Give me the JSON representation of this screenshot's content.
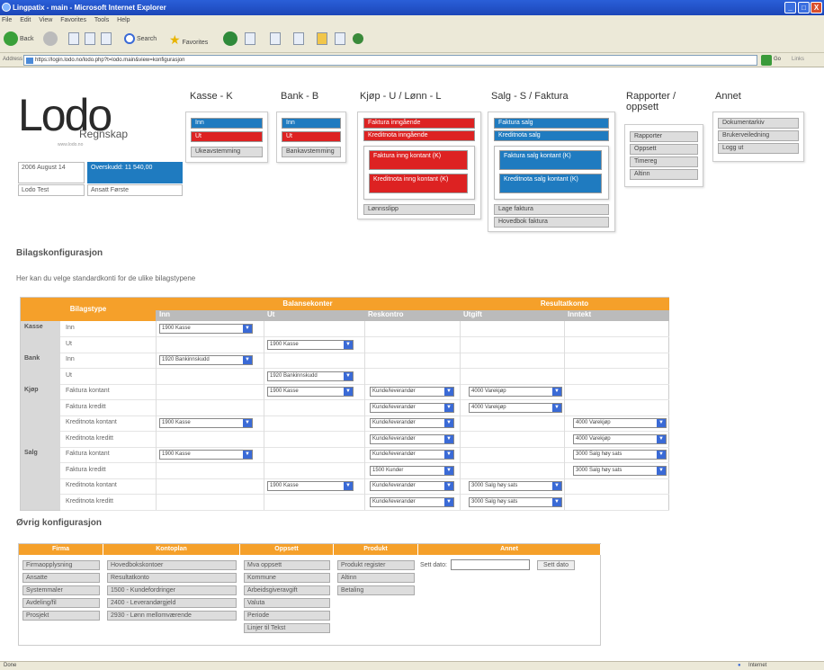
{
  "window": {
    "title": "Lingpatix - main - Microsoft Internet Explorer",
    "controls": [
      "_",
      "□",
      "X"
    ]
  },
  "menubar": [
    "File",
    "Edit",
    "View",
    "Favorites",
    "Tools",
    "Help"
  ],
  "toolbar": {
    "back": "Back",
    "search": "Search",
    "favorites": "Favorites"
  },
  "address": {
    "label": "Address",
    "url": "https://login.lodo.no/lodo.php?t=lodo.main&view=konfigurasjon",
    "go": "Go",
    "links": "Links"
  },
  "logo": {
    "text": "Lodo",
    "sub": "Regnskap",
    "url": "www.lodo.no"
  },
  "info": {
    "date": "2006 August 14",
    "balance": "Overskudd: 11 540,00",
    "company": "Lodo Test",
    "user": "Ansatt Første"
  },
  "menus": {
    "kasse": {
      "title": "Kasse - K",
      "items": [
        "Inn",
        "Ut",
        "Ukeavstemming"
      ]
    },
    "bank": {
      "title": "Bank - B",
      "items": [
        "Inn",
        "Ut",
        "Bankavstemming"
      ]
    },
    "kjop": {
      "title": "Kjøp - U / Lønn - L",
      "items": [
        "Faktura inngående",
        "Kreditnota inngående",
        "Faktura inng kontant (K)",
        "Kreditnota inng kontant (K)",
        "Lønnsslipp"
      ]
    },
    "salg": {
      "title": "Salg - S / Faktura",
      "items": [
        "Faktura salg",
        "Kreditnota salg",
        "Faktura salg kontant (K)",
        "Kreditnota salg kontant (K)",
        "Lage faktura",
        "Hovedbok faktura"
      ]
    },
    "rapporter": {
      "title": "Rapporter / oppsett",
      "items": [
        "Rapporter",
        "Oppsett",
        "Timereg",
        "Altinn"
      ]
    },
    "annet": {
      "title": "Annet",
      "items": [
        "Dokumentarkiv",
        "Brukerveiledning",
        "Logg ut"
      ]
    }
  },
  "bilag": {
    "title": "Bilagskonfigurasjon",
    "desc": "Her kan du velge standardkonti for de ulike bilagstypene",
    "col_bilagstype": "Bilagstype",
    "col_balanse": "Balansekonter",
    "col_resultat": "Resultatkonto",
    "sub": [
      "Inn",
      "Ut",
      "Reskontro",
      "Utgift",
      "Inntekt"
    ],
    "rows": [
      {
        "cat": "Kasse",
        "type": "Inn",
        "inn": "1900 Kasse",
        "ut": "",
        "resk": "",
        "utg": "",
        "innt": ""
      },
      {
        "cat": "",
        "type": "Ut",
        "inn": "",
        "ut": "1900 Kasse",
        "resk": "",
        "utg": "",
        "innt": ""
      },
      {
        "cat": "Bank",
        "type": "Inn",
        "inn": "1920 Bankinnskudd",
        "ut": "",
        "resk": "",
        "utg": "",
        "innt": ""
      },
      {
        "cat": "",
        "type": "Ut",
        "inn": "",
        "ut": "1920 Bankinnskudd",
        "resk": "",
        "utg": "",
        "innt": ""
      },
      {
        "cat": "Kjøp",
        "type": "Faktura kontant",
        "inn": "",
        "ut": "1900 Kasse",
        "resk": "Kunde/leverandør",
        "utg": "4000 Varekjøp",
        "innt": ""
      },
      {
        "cat": "",
        "type": "Faktura kreditt",
        "inn": "",
        "ut": "",
        "resk": "Kunde/leverandør",
        "utg": "4000 Varekjøp",
        "innt": ""
      },
      {
        "cat": "",
        "type": "Kreditnota kontant",
        "inn": "1900 Kasse",
        "ut": "",
        "resk": "Kunde/leverandør",
        "utg": "",
        "innt": "4000 Varekjøp"
      },
      {
        "cat": "",
        "type": "Kreditnota kreditt",
        "inn": "",
        "ut": "",
        "resk": "Kunde/leverandør",
        "utg": "",
        "innt": "4000 Varekjøp"
      },
      {
        "cat": "Salg",
        "type": "Faktura kontant",
        "inn": "1900 Kasse",
        "ut": "",
        "resk": "Kunde/leverandør",
        "utg": "",
        "innt": "3000 Salg høy sats"
      },
      {
        "cat": "",
        "type": "Faktura kreditt",
        "inn": "",
        "ut": "",
        "resk": "1500 Kunder",
        "utg": "",
        "innt": "3000 Salg høy sats"
      },
      {
        "cat": "",
        "type": "Kreditnota kontant",
        "inn": "",
        "ut": "1900 Kasse",
        "resk": "Kunde/leverandør",
        "utg": "3000 Salg høy sats",
        "innt": ""
      },
      {
        "cat": "",
        "type": "Kreditnota kreditt",
        "inn": "",
        "ut": "",
        "resk": "Kunde/leverandør",
        "utg": "3000 Salg høy sats",
        "innt": ""
      }
    ]
  },
  "ovrig": {
    "title": "Øvrig konfigurasjon",
    "cols": [
      {
        "head": "Firma",
        "items": [
          "Firmaopplysning",
          "Ansatte",
          "Systemmaler",
          "Avdeling/fil",
          "Prosjekt"
        ]
      },
      {
        "head": "Kontoplan",
        "items": [
          "Hovedbokskontoer",
          "Resultatkonto",
          "1500 - Kundefordringer",
          "2400 - Leverandørgjeld",
          "2930 - Lønn mellomværende"
        ]
      },
      {
        "head": "Oppsett",
        "items": [
          "Mva oppsett",
          "Kommune",
          "Arbeidsgiveravgift",
          "Valuta",
          "Periode",
          "Linjer til Tekst"
        ]
      },
      {
        "head": "Produkt",
        "items": [
          "Produkt register",
          "Altinn",
          "Betaling"
        ]
      },
      {
        "head": "Annet",
        "items": []
      }
    ],
    "date_label": "Sett dato:",
    "date_value": "",
    "date_button": "Sett dato"
  },
  "status": {
    "left": "Done",
    "right": "Internet"
  }
}
